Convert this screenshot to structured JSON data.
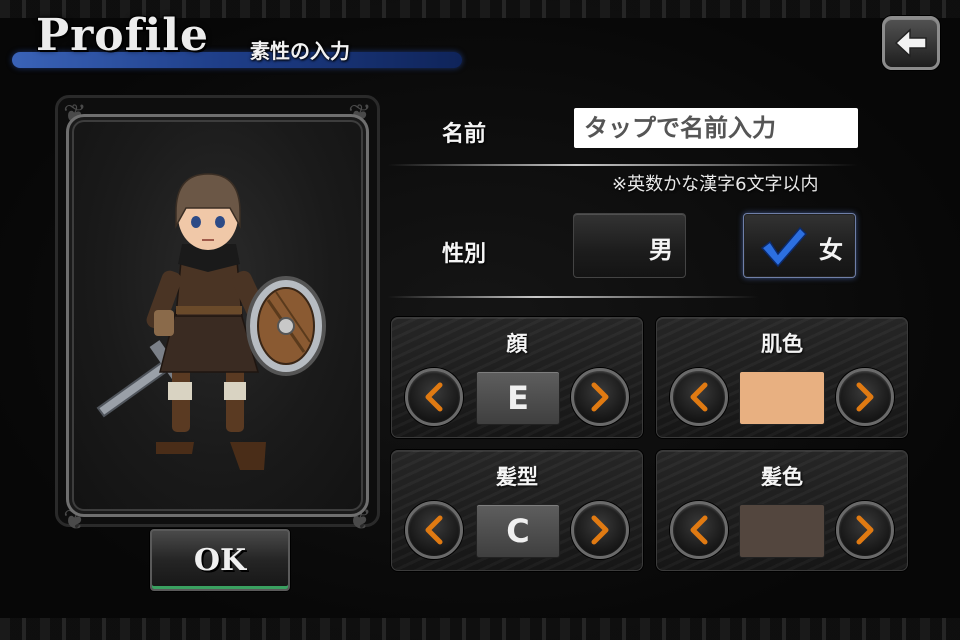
{
  "header": {
    "title": "Profile",
    "subtitle": "素性の入力"
  },
  "back_button": {
    "icon": "arrow-left-icon"
  },
  "ok_button": {
    "label": "OK"
  },
  "form": {
    "name_label": "名前",
    "name_placeholder": "タップで名前入力",
    "name_note": "※英数かな漢字6文字以内",
    "gender_label": "性別",
    "gender_options": [
      {
        "label": "男",
        "selected": false
      },
      {
        "label": "女",
        "selected": true
      }
    ]
  },
  "attributes": {
    "face": {
      "title": "顔",
      "value": "E"
    },
    "skin_color": {
      "title": "肌色",
      "color": "#E8B081"
    },
    "hairstyle": {
      "title": "髪型",
      "value": "C"
    },
    "hair_color": {
      "title": "髪色",
      "color": "#53463E"
    }
  },
  "colors": {
    "accent_arrow": "#E07A12",
    "check_mark": "#2C6FE0",
    "title_bar": "#2A4FA0"
  }
}
